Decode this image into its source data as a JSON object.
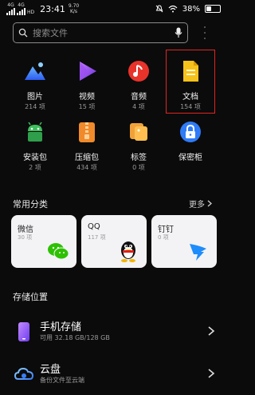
{
  "status_bar": {
    "network1": "4G",
    "network2": "4G",
    "hd": "HD",
    "time": "23:41",
    "speed_value": "9.70",
    "speed_unit": "K/s",
    "battery": "38%",
    "battery_level": 0.38
  },
  "search": {
    "placeholder": "搜索文件"
  },
  "categories": [
    {
      "label": "图片",
      "count": "214 项",
      "icon": "mountain-image-icon"
    },
    {
      "label": "视频",
      "count": "15 项",
      "icon": "play-video-icon"
    },
    {
      "label": "音频",
      "count": "4 项",
      "icon": "music-note-icon"
    },
    {
      "label": "文档",
      "count": "154 项",
      "icon": "document-icon"
    },
    {
      "label": "安装包",
      "count": "2 项",
      "icon": "android-package-icon"
    },
    {
      "label": "压缩包",
      "count": "434 项",
      "icon": "zip-archive-icon"
    },
    {
      "label": "标签",
      "count": "0 项",
      "icon": "tag-icon"
    },
    {
      "label": "保密柜",
      "count": "",
      "icon": "safe-box-icon"
    }
  ],
  "common": {
    "title": "常用分类",
    "more": "更多",
    "cards": [
      {
        "title": "微信",
        "count": "30 项",
        "icon": "wechat-icon"
      },
      {
        "title": "QQ",
        "count": "117 项",
        "icon": "qq-penguin-icon"
      },
      {
        "title": "钉钉",
        "count": "0 项",
        "icon": "dingtalk-icon"
      }
    ]
  },
  "storage": {
    "title": "存储位置",
    "items": [
      {
        "title": "手机存储",
        "subtitle": "可用 32.18 GB/128 GB",
        "icon": "phone-icon"
      },
      {
        "title": "云盘",
        "subtitle": "备份文件至云端",
        "icon": "cloud-icon"
      }
    ]
  },
  "colors": {
    "highlight_box": "#e0261e",
    "background": "#0b0b0c",
    "card": "#f3f3f5"
  }
}
